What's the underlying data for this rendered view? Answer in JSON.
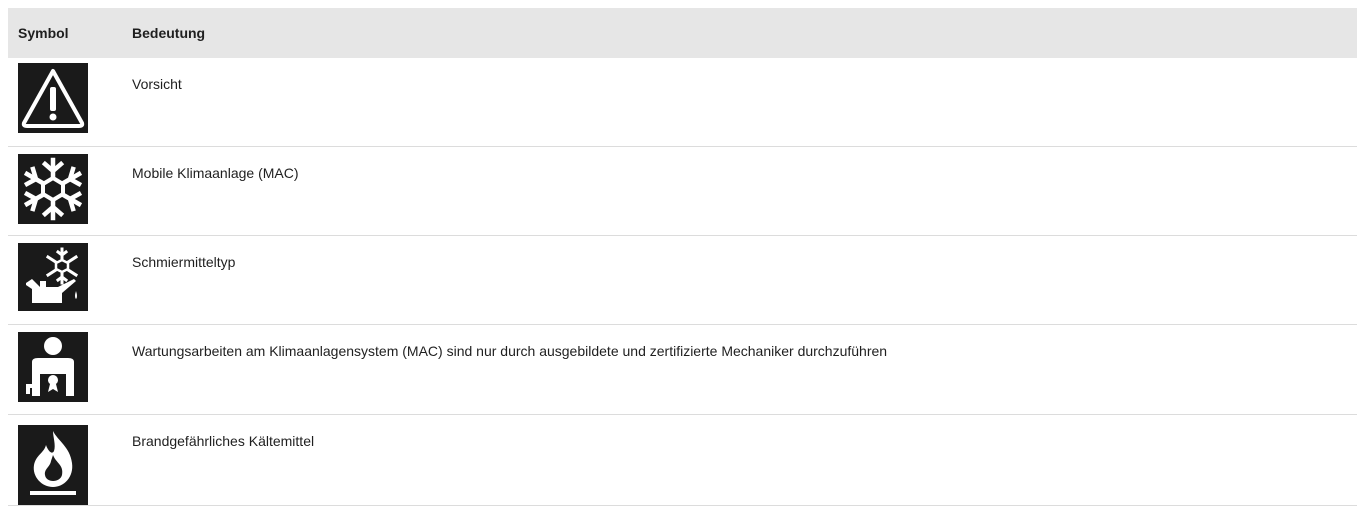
{
  "table": {
    "headers": {
      "symbol": "Symbol",
      "meaning": "Bedeutung"
    },
    "rows": [
      {
        "icon": "warning-triangle-icon",
        "text": "Vorsicht"
      },
      {
        "icon": "snowflake-icon",
        "text": "Mobile Klimaanlage (MAC)"
      },
      {
        "icon": "oil-can-snowflake-icon",
        "text": "Schmiermitteltyp"
      },
      {
        "icon": "certified-mechanic-icon",
        "text": "Wartungsarbeiten am Klimaanlagensystem (MAC) sind nur durch ausgebildete und zertifizierte Mechaniker durchzuführen"
      },
      {
        "icon": "flame-icon",
        "text": "Brandgefährliches Kältemittel"
      }
    ]
  },
  "colors": {
    "header_bg": "#e6e6e6",
    "icon_bg": "#1a1a1a",
    "icon_fg": "#ffffff",
    "divider": "#dcdcdc"
  }
}
